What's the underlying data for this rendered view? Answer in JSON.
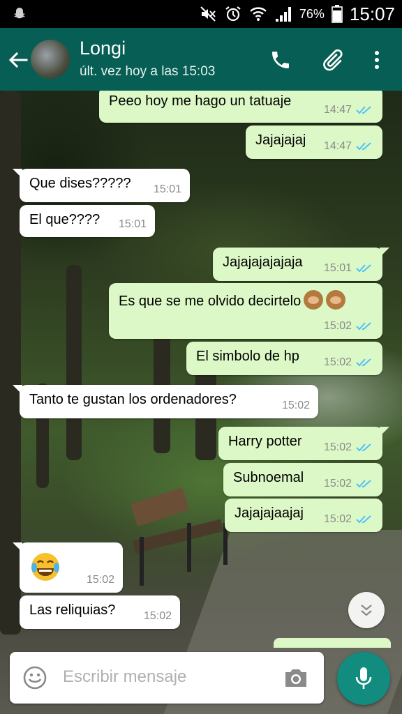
{
  "status_bar": {
    "battery_percent": "76%",
    "time": "15:07",
    "icons": [
      "ghost-icon",
      "mute-icon",
      "alarm-icon",
      "wifi-icon",
      "signal-icon",
      "battery-icon"
    ]
  },
  "header": {
    "contact_name": "Longi",
    "last_seen": "últ. vez hoy a las 15:03",
    "icons": [
      "back-arrow-icon",
      "phone-icon",
      "paperclip-icon",
      "more-vert-icon"
    ]
  },
  "messages": [
    {
      "dir": "out",
      "text": "Peeo hoy me hago un tatuaje",
      "time": "14:47",
      "read": true
    },
    {
      "dir": "out",
      "text": "Jajajajaj",
      "time": "14:47",
      "read": true
    },
    {
      "dir": "in",
      "text": "Que dises?????",
      "time": "15:01"
    },
    {
      "dir": "in",
      "text": "El que????",
      "time": "15:01"
    },
    {
      "dir": "out",
      "text": "Jajajajajajaja",
      "time": "15:01",
      "read": true
    },
    {
      "dir": "out",
      "text": "Es que se me olvido decirtelo",
      "emoji": "see-no-evil-monkey ×2",
      "time": "15:02",
      "read": true
    },
    {
      "dir": "out",
      "text": "El simbolo de hp",
      "time": "15:02",
      "read": true
    },
    {
      "dir": "in",
      "text": "Tanto te gustan los ordenadores?",
      "time": "15:02"
    },
    {
      "dir": "out",
      "text": "Harry potter",
      "time": "15:02",
      "read": true
    },
    {
      "dir": "out",
      "text": "Subnoemal",
      "time": "15:02",
      "read": true
    },
    {
      "dir": "out",
      "text": "Jajajajaajaj",
      "time": "15:02",
      "read": true
    },
    {
      "dir": "in",
      "emoji": "face-with-tears-of-joy",
      "time": "15:02"
    },
    {
      "dir": "in",
      "text": "Las reliquias?",
      "time": "15:02"
    }
  ],
  "composer": {
    "placeholder": "Escribir mensaje",
    "icons": [
      "smiley-icon",
      "camera-icon",
      "mic-icon"
    ]
  },
  "colors": {
    "header": "#075e54",
    "outgoing_bubble": "#dcf8c6",
    "incoming_bubble": "#ffffff",
    "read_ticks": "#4fc3f7",
    "mic_button": "#128c7e"
  }
}
